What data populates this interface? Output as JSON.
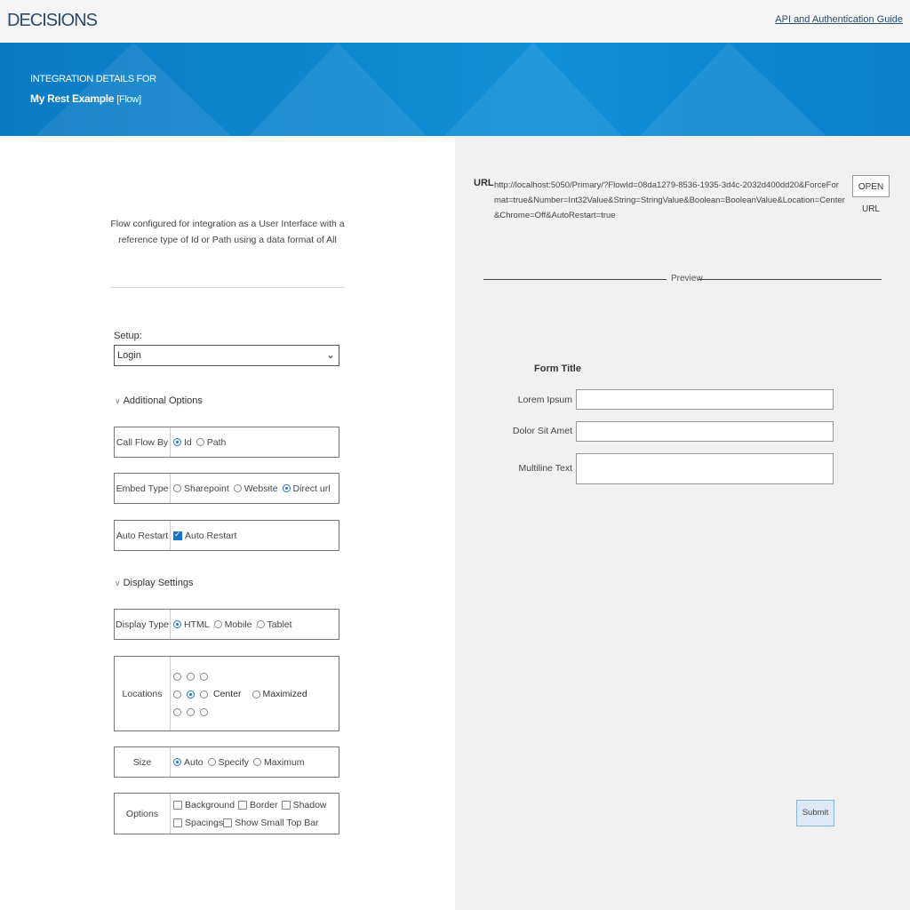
{
  "header": {
    "logo": "DECISIONS",
    "guide_link": "API and Authentication Guide"
  },
  "banner": {
    "line1": "INTEGRATION DETAILS FOR",
    "name": "My Rest Example",
    "type": "[Flow]"
  },
  "left": {
    "description": "Flow configured for integration as a User Interface with a reference type of Id or Path using a data format of All",
    "setup": {
      "label": "Setup:",
      "value": "Login"
    },
    "additional_options": "Additional Options",
    "call_flow_by": {
      "label": "Call Flow By",
      "options": [
        "Id",
        "Path"
      ],
      "selected": "Id"
    },
    "embed_type": {
      "label": "Embed Type",
      "options": [
        "Sharepoint",
        "Website",
        "Direct url"
      ],
      "selected": "Direct url"
    },
    "auto_restart": {
      "label": "Auto Restart",
      "checkbox_label": "Auto Restart",
      "checked": true
    },
    "display_settings": "Display Settings",
    "display_type": {
      "label": "Display Type",
      "options": [
        "HTML",
        "Mobile",
        "Tablet"
      ],
      "selected": "HTML"
    },
    "locations": {
      "label": "Locations",
      "center_label": "Center",
      "maximized_label": "Maximized",
      "selected": "middle-center"
    },
    "size": {
      "label": "Size",
      "options": [
        "Auto",
        "Specify",
        "Maximum"
      ],
      "selected": "Auto"
    },
    "options": {
      "label": "Options",
      "checkboxes": [
        "Background",
        "Border",
        "Shadow",
        "Spacings",
        "Show Small Top Bar"
      ]
    }
  },
  "right": {
    "url_label": "URL",
    "url": "http://localhost:5050/Primary/?FlowId=08da1279-8536-1935-3d4c-2032d400dd20&ForceFormat=true&Number=Int32Value&String=StringValue&Boolean=BooleanValue&Location=Center&Chrome=Off&AutoRestart=true",
    "open_url": "OPEN URL",
    "preview_label": "Preview",
    "form": {
      "title": "Form Title",
      "fields": [
        "Lorem Ipsum",
        "Dolor Sit Amet",
        "Multiline Text"
      ],
      "submit": "Submit"
    }
  },
  "colors": {
    "banner": "#0b7ac4",
    "accent": "#1a73c7",
    "logo": "#2b4a6b"
  }
}
